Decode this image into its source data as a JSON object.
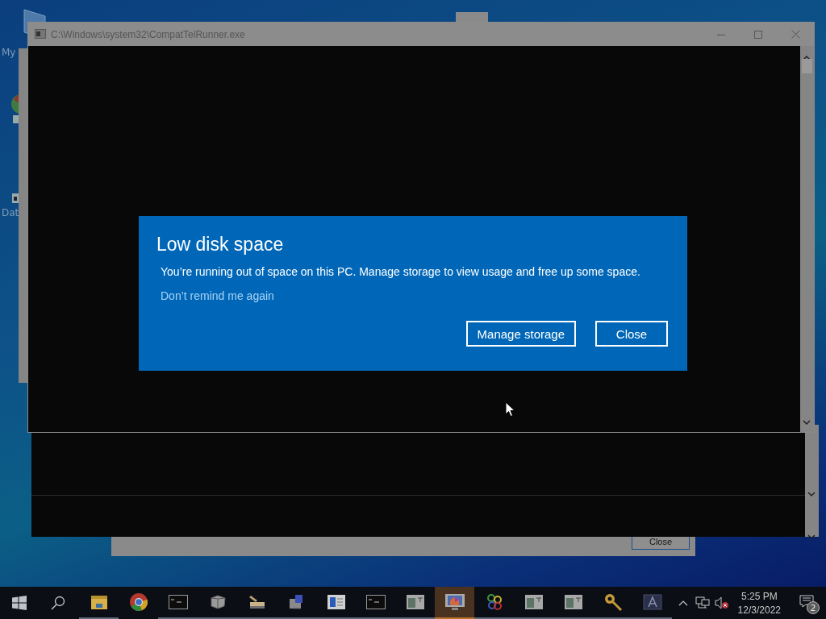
{
  "desktop_icons": [
    {
      "label": "My"
    },
    {
      "label": "Dat"
    }
  ],
  "background_window": {
    "button": "Close"
  },
  "console_window": {
    "title": "C:\\Windows\\system32\\CompatTelRunner.exe"
  },
  "dialog": {
    "title": "Low disk space",
    "message": "You’re running out of space on this PC. Manage storage to view usage and free up some space.",
    "link": "Don’t remind me again",
    "buttons": [
      "Manage storage",
      "Close"
    ]
  },
  "taskbar": {
    "apps": [
      {
        "kind": "folder",
        "running": true,
        "selected": false
      },
      {
        "kind": "chrome",
        "running": false,
        "selected": false
      },
      {
        "kind": "console",
        "running": true,
        "selected": false
      },
      {
        "kind": "dice",
        "running": true,
        "selected": false
      },
      {
        "kind": "scanner",
        "running": true,
        "selected": false
      },
      {
        "kind": "network",
        "running": true,
        "selected": false
      },
      {
        "kind": "form",
        "running": true,
        "selected": false
      },
      {
        "kind": "console",
        "running": true,
        "selected": false
      },
      {
        "kind": "window",
        "running": true,
        "selected": false
      },
      {
        "kind": "monitor",
        "running": true,
        "selected": true
      },
      {
        "kind": "colors",
        "running": true,
        "selected": false
      },
      {
        "kind": "window",
        "running": true,
        "selected": false
      },
      {
        "kind": "window",
        "running": true,
        "selected": false
      },
      {
        "kind": "key",
        "running": true,
        "selected": false
      },
      {
        "kind": "font",
        "running": true,
        "selected": false
      }
    ],
    "time": "5:25 PM",
    "date": "12/3/2022",
    "notification_count": "2"
  }
}
